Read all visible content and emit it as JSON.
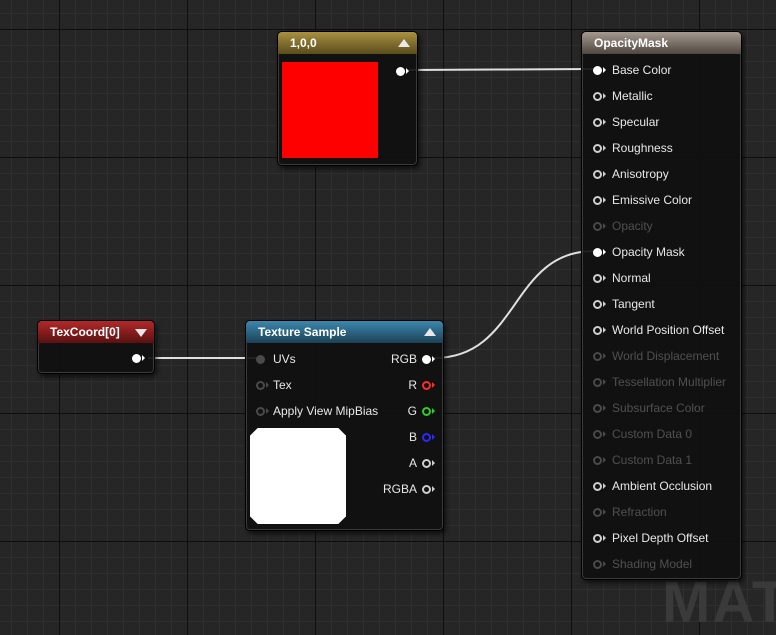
{
  "constant_node": {
    "title": "1,0,0",
    "swatch_color": "#ff0000"
  },
  "texcoord_node": {
    "title": "TexCoord[0]"
  },
  "texture_node": {
    "title": "Texture Sample",
    "inputs": [
      "UVs",
      "Tex",
      "Apply View MipBias"
    ],
    "outputs": [
      "RGB",
      "R",
      "G",
      "B",
      "A",
      "RGBA"
    ],
    "output_colors": [
      "#ffffff",
      "#ff2a2a",
      "#2ad12a",
      "#2a2aff",
      "#cfcfcf",
      "#cfcfcf"
    ]
  },
  "material_node": {
    "title": "OpacityMask",
    "pins": [
      {
        "label": "Base Color",
        "state": "connected"
      },
      {
        "label": "Metallic",
        "state": "active"
      },
      {
        "label": "Specular",
        "state": "active"
      },
      {
        "label": "Roughness",
        "state": "active"
      },
      {
        "label": "Anisotropy",
        "state": "active"
      },
      {
        "label": "Emissive Color",
        "state": "active"
      },
      {
        "label": "Opacity",
        "state": "disabled"
      },
      {
        "label": "Opacity Mask",
        "state": "connected"
      },
      {
        "label": "Normal",
        "state": "active"
      },
      {
        "label": "Tangent",
        "state": "active"
      },
      {
        "label": "World Position Offset",
        "state": "active"
      },
      {
        "label": "World Displacement",
        "state": "disabled"
      },
      {
        "label": "Tessellation Multiplier",
        "state": "disabled"
      },
      {
        "label": "Subsurface Color",
        "state": "disabled"
      },
      {
        "label": "Custom Data 0",
        "state": "disabled"
      },
      {
        "label": "Custom Data 1",
        "state": "disabled"
      },
      {
        "label": "Ambient Occlusion",
        "state": "active"
      },
      {
        "label": "Refraction",
        "state": "disabled"
      },
      {
        "label": "Pixel Depth Offset",
        "state": "active"
      },
      {
        "label": "Shading Model",
        "state": "disabled"
      }
    ]
  },
  "watermark": "MAT"
}
